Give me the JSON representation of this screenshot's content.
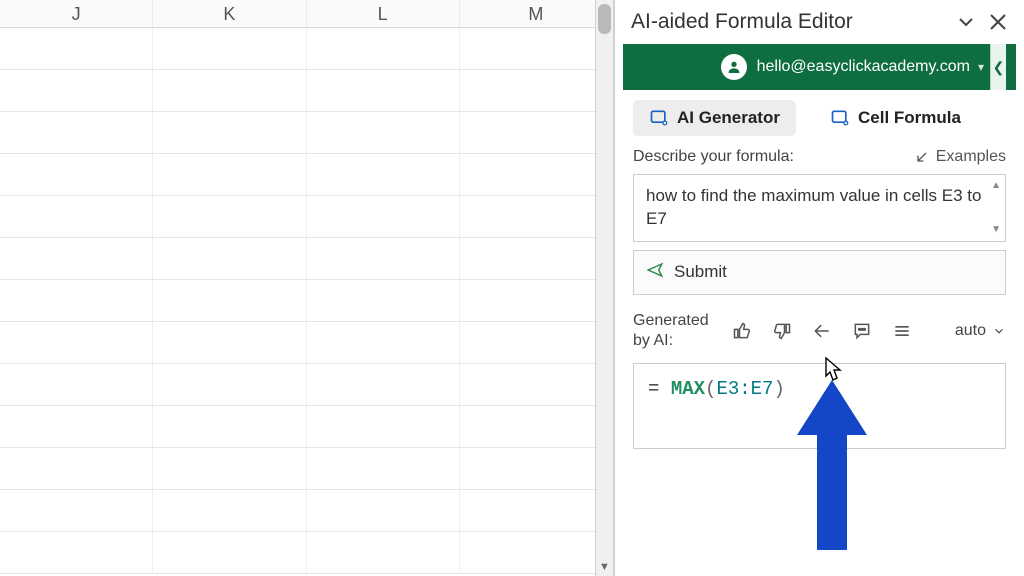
{
  "sheet": {
    "columns": [
      "J",
      "K",
      "L",
      "M"
    ]
  },
  "panel": {
    "title": "AI-aided Formula Editor",
    "account_email": "hello@easyclickacademy.com",
    "tabs": {
      "generator": "AI Generator",
      "cellformula": "Cell Formula"
    },
    "describe_label": "Describe your formula:",
    "examples_label": "Examples",
    "describe_text": "how to find the maximum value in cells E3 to E7",
    "submit_label": "Submit",
    "generated_label_line1": "Generated",
    "generated_label_line2": "by AI:",
    "auto_label": "auto",
    "formula": {
      "eq": "= ",
      "fn": "MAX",
      "open": "(",
      "args": "E3:E7",
      "close": ")"
    }
  }
}
